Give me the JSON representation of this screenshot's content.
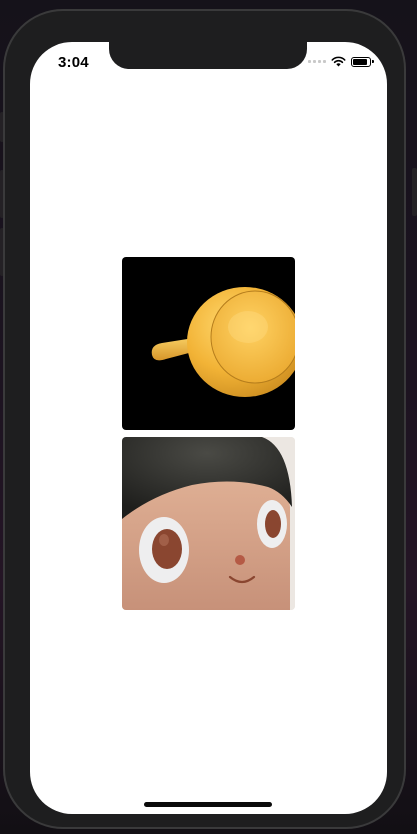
{
  "status_bar": {
    "time": "3:04",
    "icons": [
      "cellular-signal-icon",
      "wifi-icon",
      "battery-icon"
    ],
    "battery_level": 0.9
  },
  "gallery": {
    "items": [
      {
        "icon": "bell-pepper-3d-render",
        "background": "#000000"
      },
      {
        "icon": "octocat-figurine-face",
        "background": "#ece7e2"
      }
    ]
  },
  "colors": {
    "screen_background": "#ffffff",
    "device_frame": "#1e1e1f",
    "object_yellow": "#f2b336"
  }
}
